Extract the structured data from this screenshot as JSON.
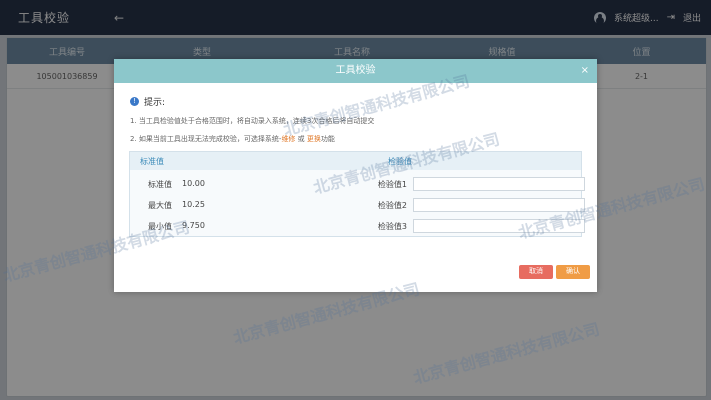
{
  "header": {
    "title": "工具校验",
    "back_symbol": "←",
    "user_label": "系统超级...",
    "logout_label": "退出"
  },
  "table": {
    "columns": [
      "工具编号",
      "类型",
      "工具名称",
      "规格值",
      "位置"
    ],
    "rows": [
      [
        "105001036859",
        "",
        "",
        "",
        "2-1"
      ]
    ]
  },
  "modal": {
    "title": "工具校验",
    "close_symbol": "×",
    "notice_title": "提示:",
    "notes": {
      "n1": "1. 当工具检验值处于合格范围时，将自动录入系统，连续3次合格后将自动提交",
      "n2_prefix": "2. 如果当前工具出现无法完成校验，可选择系统-",
      "n2_hl1": "维修",
      "n2_mid": " 或 ",
      "n2_hl2": "更换",
      "n2_suffix": "功能"
    },
    "std_header": "标准值",
    "check_header": "检验值",
    "standard": [
      {
        "label": "标准值",
        "value": "10.00"
      },
      {
        "label": "最大值",
        "value": "10.25"
      },
      {
        "label": "最小值",
        "value": "9.750"
      }
    ],
    "checks": [
      {
        "label": "检验值1",
        "value": ""
      },
      {
        "label": "检验值2",
        "value": ""
      },
      {
        "label": "检验值3",
        "value": ""
      }
    ],
    "buttons": {
      "cancel": "取消",
      "confirm": "确认"
    }
  },
  "watermark_text": "北京青创智通科技有限公司"
}
